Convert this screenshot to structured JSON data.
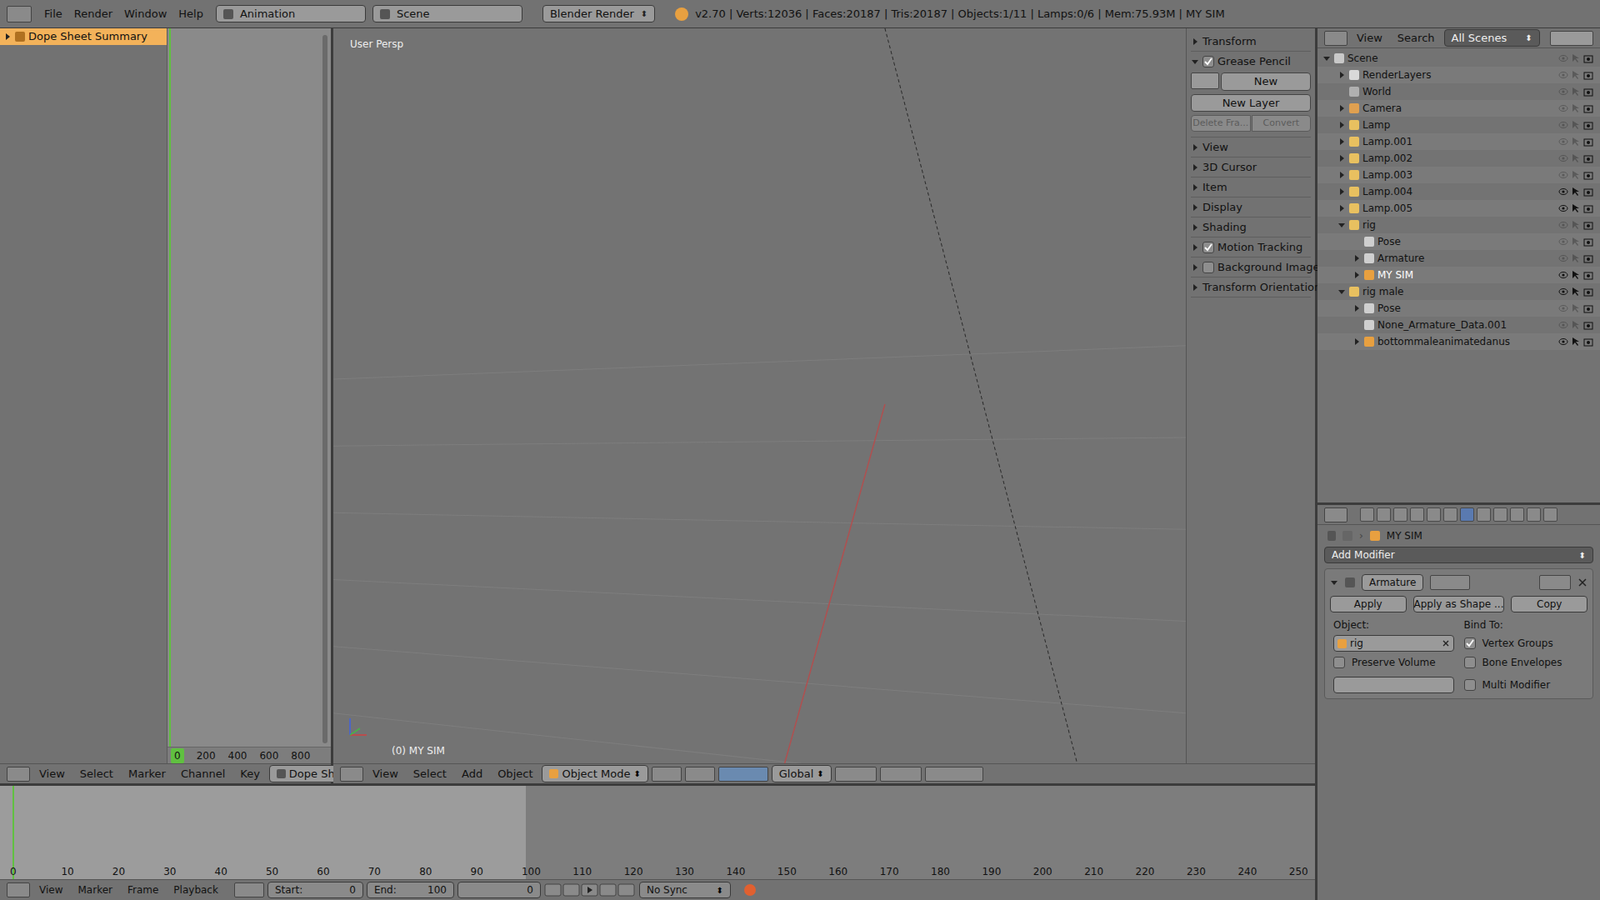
{
  "info_bar": {
    "menus": [
      "File",
      "Render",
      "Window",
      "Help"
    ],
    "layout": "Animation",
    "scene": "Scene",
    "engine": "Blender Render",
    "stats": "v2.70 | Verts:12036 | Faces:20187 | Tris:20187 | Objects:1/11 | Lamps:0/6 | Mem:75.93M | MY SIM"
  },
  "dope_sheet": {
    "channels": [
      {
        "label": "Dope Sheet Summary",
        "selected": true
      }
    ],
    "current_frame": "0",
    "ruler": [
      "200",
      "400",
      "600",
      "800"
    ],
    "menus": [
      "View",
      "Select",
      "Marker",
      "Channel",
      "Key"
    ],
    "mode": "Dope Sheet"
  },
  "viewport": {
    "view_label": "User Persp",
    "object_label": "(0) MY SIM",
    "menus": [
      "View",
      "Select",
      "Add",
      "Object"
    ],
    "mode": "Object Mode",
    "orientation": "Global"
  },
  "n_panel": {
    "sections": [
      {
        "label": "Transform",
        "expanded": false,
        "kind": "plain",
        "checked": false
      },
      {
        "label": "Grease Pencil",
        "expanded": true,
        "kind": "toggle",
        "checked": true
      },
      {
        "label": "View",
        "expanded": false,
        "kind": "plain",
        "checked": false
      },
      {
        "label": "3D Cursor",
        "expanded": false,
        "kind": "plain",
        "checked": false
      },
      {
        "label": "Item",
        "expanded": false,
        "kind": "plain",
        "checked": false
      },
      {
        "label": "Display",
        "expanded": false,
        "kind": "plain",
        "checked": false
      },
      {
        "label": "Shading",
        "expanded": false,
        "kind": "plain",
        "checked": false
      },
      {
        "label": "Motion Tracking",
        "expanded": false,
        "kind": "toggle",
        "checked": true
      },
      {
        "label": "Background Images",
        "expanded": false,
        "kind": "toggle",
        "checked": false
      },
      {
        "label": "Transform Orientations",
        "expanded": false,
        "kind": "plain",
        "checked": false
      }
    ],
    "grease_pencil": {
      "new": "New",
      "new_layer": "New Layer",
      "delete": "Delete Fra...",
      "convert": "Convert",
      "disabled": true
    }
  },
  "outliner": {
    "menus": [
      "View",
      "Search"
    ],
    "filter": "All Scenes",
    "items": [
      {
        "label": "Scene",
        "depth": 0,
        "kind": "scene",
        "expandable": true,
        "expanded": true,
        "visible": false,
        "active": false
      },
      {
        "label": "RenderLayers",
        "depth": 1,
        "kind": "layers",
        "expandable": true,
        "expanded": false,
        "visible": false,
        "active": false
      },
      {
        "label": "World",
        "depth": 1,
        "kind": "world",
        "expandable": false,
        "expanded": false,
        "visible": false,
        "active": false
      },
      {
        "label": "Camera",
        "depth": 1,
        "kind": "camera",
        "expandable": true,
        "expanded": false,
        "visible": false,
        "active": false
      },
      {
        "label": "Lamp",
        "depth": 1,
        "kind": "lamp",
        "expandable": true,
        "expanded": false,
        "visible": false,
        "active": false
      },
      {
        "label": "Lamp.001",
        "depth": 1,
        "kind": "lamp",
        "expandable": true,
        "expanded": false,
        "visible": false,
        "active": false
      },
      {
        "label": "Lamp.002",
        "depth": 1,
        "kind": "lamp",
        "expandable": true,
        "expanded": false,
        "visible": false,
        "active": false
      },
      {
        "label": "Lamp.003",
        "depth": 1,
        "kind": "lamp",
        "expandable": true,
        "expanded": false,
        "visible": false,
        "active": false
      },
      {
        "label": "Lamp.004",
        "depth": 1,
        "kind": "lamp",
        "expandable": true,
        "expanded": false,
        "visible": true,
        "active": false
      },
      {
        "label": "Lamp.005",
        "depth": 1,
        "kind": "lamp",
        "expandable": true,
        "expanded": false,
        "visible": true,
        "active": false
      },
      {
        "label": "rig",
        "depth": 1,
        "kind": "armature",
        "expandable": true,
        "expanded": true,
        "visible": false,
        "active": false
      },
      {
        "label": "Pose",
        "depth": 2,
        "kind": "pose",
        "expandable": false,
        "expanded": false,
        "visible": false,
        "active": false
      },
      {
        "label": "Armature",
        "depth": 2,
        "kind": "data",
        "expandable": true,
        "expanded": false,
        "visible": false,
        "active": false
      },
      {
        "label": "MY SIM",
        "depth": 2,
        "kind": "mesh",
        "expandable": true,
        "expanded": false,
        "visible": true,
        "active": true
      },
      {
        "label": "rig male",
        "depth": 1,
        "kind": "armature",
        "expandable": true,
        "expanded": true,
        "visible": true,
        "active": false
      },
      {
        "label": "Pose",
        "depth": 2,
        "kind": "pose",
        "expandable": true,
        "expanded": false,
        "visible": false,
        "active": false
      },
      {
        "label": "None_Armature_Data.001",
        "depth": 2,
        "kind": "data",
        "expandable": false,
        "expanded": false,
        "visible": false,
        "active": false
      },
      {
        "label": "bottommaleanimatedanus",
        "depth": 2,
        "kind": "mesh",
        "expandable": true,
        "expanded": false,
        "visible": true,
        "active": false
      }
    ]
  },
  "properties": {
    "breadcrumb": "MY SIM",
    "add_modifier": "Add Modifier",
    "modifier": {
      "name": "Armature",
      "buttons": [
        "Apply",
        "Apply as Shape ...",
        "Copy"
      ],
      "object_label": "Object:",
      "object": "rig",
      "bind_label": "Bind To:",
      "options": [
        {
          "label": "Preserve Volume",
          "checked": false
        },
        {
          "label": "Vertex Groups",
          "checked": true
        },
        {
          "label": "Bone Envelopes",
          "checked": false
        },
        {
          "label": "Multi Modifier",
          "checked": false
        }
      ]
    }
  },
  "timeline": {
    "ticks": [
      "0",
      "10",
      "20",
      "30",
      "40",
      "50",
      "60",
      "70",
      "80",
      "90",
      "100",
      "110",
      "120",
      "130",
      "140",
      "150",
      "160",
      "170",
      "180",
      "190",
      "200",
      "210",
      "220",
      "230",
      "240",
      "250"
    ],
    "menus": [
      "View",
      "Marker",
      "Frame",
      "Playback"
    ],
    "start": "Start:",
    "start_value": "0",
    "end": "End:",
    "end_value": "100",
    "current": "0",
    "sync": "No Sync"
  }
}
